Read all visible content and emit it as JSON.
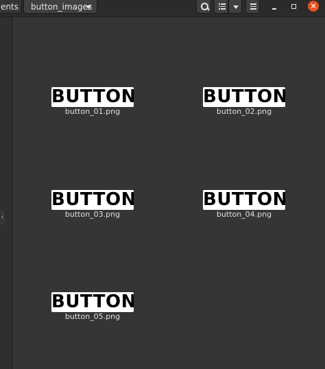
{
  "window": {
    "breadcrumb_prev": "ents",
    "breadcrumb_current": "button_images",
    "close_glyph": "✕"
  },
  "icons": {
    "search": "search-icon",
    "view": "list-view-icon",
    "view_dropdown": "chevron-down-icon",
    "menu": "hamburger-menu-icon",
    "minimize": "minimize-icon",
    "maximize": "maximize-icon",
    "close": "close-icon",
    "sidebar_toggle": "chevron-left-icon"
  },
  "colors": {
    "background": "#353535",
    "headerbar": "#2b2b2b",
    "close_button": "#e2521c"
  },
  "files": [
    {
      "thumb_text": "BUTTON",
      "name": "button_01.png"
    },
    {
      "thumb_text": "BUTTON",
      "name": "button_02.png"
    },
    {
      "thumb_text": "BUTTON",
      "name": "button_03.png"
    },
    {
      "thumb_text": "BUTTON",
      "name": "button_04.png"
    },
    {
      "thumb_text": "BUTTON",
      "name": "button_05.png"
    }
  ]
}
